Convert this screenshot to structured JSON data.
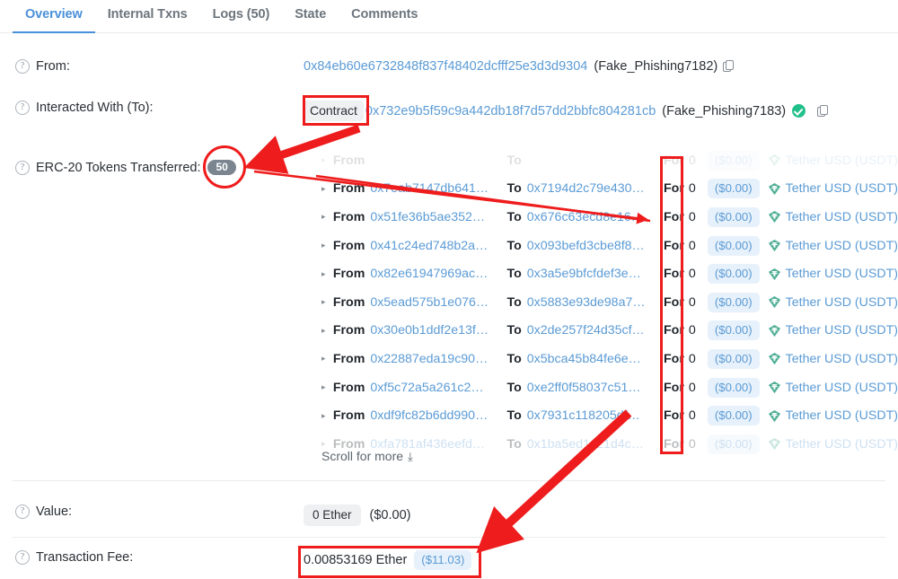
{
  "tabs": [
    {
      "label": "Overview",
      "active": true
    },
    {
      "label": "Internal Txns",
      "active": false
    },
    {
      "label": "Logs (50)",
      "active": false
    },
    {
      "label": "State",
      "active": false
    },
    {
      "label": "Comments",
      "active": false
    }
  ],
  "fields": {
    "from_label": "From:",
    "from_address": "0x84eb60e6732848f837f48402dcfff25e3d3d9304",
    "from_tag": "(Fake_Phishing7182)",
    "to_label": "Interacted With (To):",
    "to_prefix": "Contract",
    "to_address": "0x732e9b5f59c9a442db18f7d57dd2bbfc804281cb",
    "to_tag": "(Fake_Phishing7183)",
    "erc20_label": "ERC-20 Tokens Transferred:",
    "erc20_count": "50",
    "value_label": "Value:",
    "value_amount": "0 Ether",
    "value_usd": "($0.00)",
    "fee_label": "Transaction Fee:",
    "fee_amount": "0.00853169 Ether",
    "fee_usd": "($11.03)"
  },
  "transfers": {
    "kw_from": "From",
    "kw_to": "To",
    "kw_for": "For",
    "scroll_more": "Scroll for more",
    "rows": [
      {
        "from": "",
        "to": "",
        "amount": "0",
        "usd": "($0.00)",
        "token": "Tether USD (USDT)",
        "state": "faded-top"
      },
      {
        "from": "0x7eab7147db641…",
        "to": "0x7194d2c79e430…",
        "amount": "0",
        "usd": "($0.00)",
        "token": "Tether USD (USDT)",
        "state": ""
      },
      {
        "from": "0x51fe36b5ae352…",
        "to": "0x676c63ecd8e16…",
        "amount": "0",
        "usd": "($0.00)",
        "token": "Tether USD (USDT)",
        "state": ""
      },
      {
        "from": "0x41c24ed748b2a…",
        "to": "0x093befd3cbe8f8…",
        "amount": "0",
        "usd": "($0.00)",
        "token": "Tether USD (USDT)",
        "state": ""
      },
      {
        "from": "0x82e61947969ac…",
        "to": "0x3a5e9bfcfdef3e…",
        "amount": "0",
        "usd": "($0.00)",
        "token": "Tether USD (USDT)",
        "state": ""
      },
      {
        "from": "0x5ead575b1e076…",
        "to": "0x5883e93de98a7…",
        "amount": "0",
        "usd": "($0.00)",
        "token": "Tether USD (USDT)",
        "state": ""
      },
      {
        "from": "0x30e0b1ddf2e13f…",
        "to": "0x2de257f24d35cf…",
        "amount": "0",
        "usd": "($0.00)",
        "token": "Tether USD (USDT)",
        "state": ""
      },
      {
        "from": "0x22887eda19c90…",
        "to": "0x5bca45b84fe6e…",
        "amount": "0",
        "usd": "($0.00)",
        "token": "Tether USD (USDT)",
        "state": ""
      },
      {
        "from": "0xf5c72a5a261c2…",
        "to": "0xe2ff0f58037c51…",
        "amount": "0",
        "usd": "($0.00)",
        "token": "Tether USD (USDT)",
        "state": ""
      },
      {
        "from": "0xdf9fc82b6dd990…",
        "to": "0x7931c118205df…",
        "amount": "0",
        "usd": "($0.00)",
        "token": "Tether USD (USDT)",
        "state": ""
      },
      {
        "from": "0xfa781af436eefd…",
        "to": "0x1ba5ed1c21d4c…",
        "amount": "0",
        "usd": "($0.00)",
        "token": "Tether USD (USDT)",
        "state": "faded"
      }
    ]
  },
  "colors": {
    "accent_blue": "#4a90d9",
    "link_blue": "#5b9bd5",
    "annotation_red": "#ee1c1c",
    "verified_green": "#21c08b",
    "tether_green": "#50af95",
    "badge_grey": "#7a8590"
  }
}
